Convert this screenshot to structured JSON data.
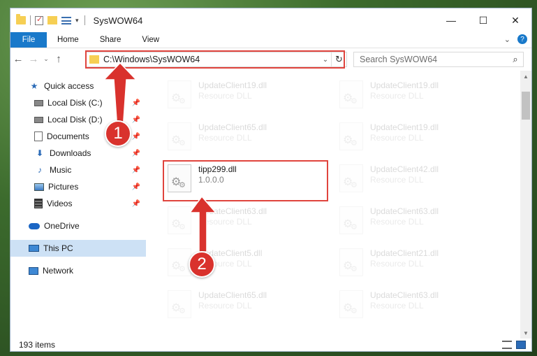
{
  "window": {
    "title": "SysWOW64"
  },
  "ribbon": {
    "tabs": [
      "File",
      "Home",
      "Share",
      "View"
    ]
  },
  "address": {
    "path": "C:\\Windows\\SysWOW64"
  },
  "search": {
    "placeholder": "Search SysWOW64"
  },
  "nav": {
    "items": [
      {
        "label": "Quick access",
        "icon": "star-icon"
      },
      {
        "label": "Local Disk (C:)",
        "icon": "drive-icon",
        "pinned": true
      },
      {
        "label": "Local Disk (D:)",
        "icon": "drive-icon",
        "pinned": true
      },
      {
        "label": "Documents",
        "icon": "documents-icon",
        "pinned": true
      },
      {
        "label": "Downloads",
        "icon": "downloads-icon",
        "pinned": true
      },
      {
        "label": "Music",
        "icon": "music-icon",
        "pinned": true
      },
      {
        "label": "Pictures",
        "icon": "pictures-icon",
        "pinned": true
      },
      {
        "label": "Videos",
        "icon": "videos-icon",
        "pinned": true
      },
      {
        "label": "OneDrive",
        "icon": "onedrive-icon"
      },
      {
        "label": "This PC",
        "icon": "pc-icon",
        "selected": true
      },
      {
        "label": "Network",
        "icon": "network-icon"
      }
    ]
  },
  "files": [
    {
      "name": "UpdateClient19.dll",
      "desc": "Resource DLL"
    },
    {
      "name": "UpdateClient19.dll",
      "desc": "Resource DLL"
    },
    {
      "name": "UpdateClient65.dll",
      "desc": "Resource DLL"
    },
    {
      "name": "UpdateClient19.dll",
      "desc": "Resource DLL"
    },
    {
      "name": "tipp299.dll",
      "desc": "1.0.0.0",
      "highlighted": true
    },
    {
      "name": "UpdateClient42.dll",
      "desc": "Resource DLL"
    },
    {
      "name": "UpdateClient63.dll",
      "desc": "Resource DLL"
    },
    {
      "name": "UpdateClient63.dll",
      "desc": "Resource DLL"
    },
    {
      "name": "UpdateClient5.dll",
      "desc": "Resource DLL"
    },
    {
      "name": "UpdateClient21.dll",
      "desc": "Resource DLL"
    },
    {
      "name": "UpdateClient65.dll",
      "desc": "Resource DLL"
    },
    {
      "name": "UpdateClient63.dll",
      "desc": "Resource DLL"
    }
  ],
  "status": {
    "count": "193 items"
  },
  "annotations": {
    "step1": "1",
    "step2": "2",
    "color": "#d9322d"
  }
}
